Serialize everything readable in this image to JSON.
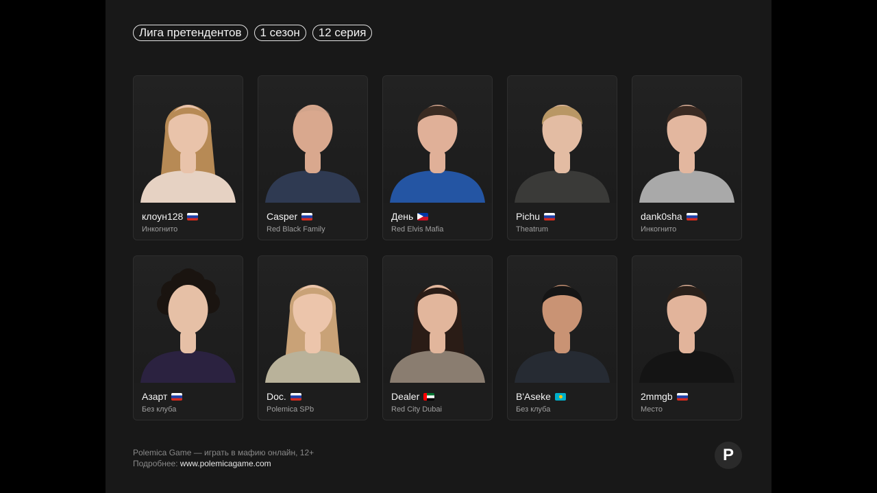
{
  "tags": [
    "Лига претендентов",
    "1 сезон",
    "12 серия"
  ],
  "players": [
    {
      "nick": "клоун128",
      "flag": "flag-ru",
      "club": "Инкогнито",
      "hair": "#b78a55",
      "skin": "#e9c3aa",
      "shirt": "#e6d2c3",
      "hairstyle": "long"
    },
    {
      "nick": "Casper",
      "flag": "flag-ru",
      "club": "Red Black Family",
      "hair": "#c79d86",
      "skin": "#d9a88e",
      "shirt": "#2f3a52",
      "hairstyle": "bald"
    },
    {
      "nick": "День",
      "flag": "flag-ph",
      "club": "Red Elvis Mafia",
      "hair": "#3a2b22",
      "skin": "#e0b098",
      "shirt": "#2455a3",
      "hairstyle": "short"
    },
    {
      "nick": "Pichu",
      "flag": "flag-ru",
      "club": "Theatrum",
      "hair": "#b99765",
      "skin": "#e3bca3",
      "shirt": "#3a3a38",
      "hairstyle": "short"
    },
    {
      "nick": "dank0sha",
      "flag": "flag-ru",
      "club": "Инкогнито",
      "hair": "#3a2a22",
      "skin": "#e3b79f",
      "shirt": "#a9a9a9",
      "hairstyle": "short"
    },
    {
      "nick": "Азарт",
      "flag": "flag-ru",
      "club": "Без клуба",
      "hair": "#1a1410",
      "skin": "#e6c0a6",
      "shirt": "#2b2240",
      "hairstyle": "curly"
    },
    {
      "nick": "Doc.",
      "flag": "flag-ru",
      "club": "Polemica SPb",
      "hair": "#c9a277",
      "skin": "#ecc5ab",
      "shirt": "#b9b29a",
      "hairstyle": "long"
    },
    {
      "nick": "Dealer",
      "flag": "flag-ae",
      "club": "Red City Dubai",
      "hair": "#2a1c16",
      "skin": "#e2b69c",
      "shirt": "#8a7d70",
      "hairstyle": "long"
    },
    {
      "nick": "B'Aseke",
      "flag": "flag-kz",
      "club": "Без клуба",
      "hair": "#151515",
      "skin": "#c99374",
      "shirt": "#262b33",
      "hairstyle": "short"
    },
    {
      "nick": "2mmgb",
      "flag": "flag-ru",
      "club": "Место",
      "hair": "#2a201a",
      "skin": "#e2b49b",
      "shirt": "#141414",
      "hairstyle": "short"
    }
  ],
  "footer": {
    "line1": "Polemica Game — играть в мафию онлайн, 12+",
    "line2_prefix": "Подробнее: ",
    "url": "www.polemicagame.com"
  },
  "logo": "P"
}
